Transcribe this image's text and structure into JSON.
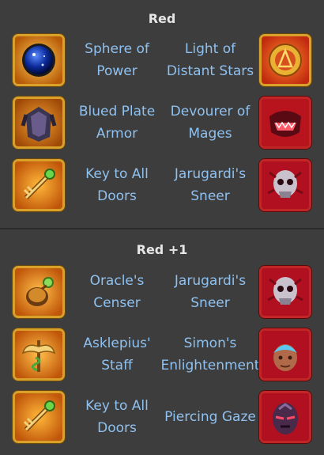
{
  "sections": [
    {
      "title": "Red",
      "rows": [
        {
          "left_name": "Sphere of\nPower",
          "left_icon": "sphere-of-power-icon",
          "right_name": "Light of\nDistant Stars",
          "right_icon": "light-of-distant-stars-icon"
        },
        {
          "left_name": "Blued Plate\nArmor",
          "left_icon": "blued-plate-armor-icon",
          "right_name": "Devourer of\nMages",
          "right_icon": "devourer-of-mages-icon"
        },
        {
          "left_name": "Key to All\nDoors",
          "left_icon": "key-to-all-doors-icon",
          "right_name": "Jarugardi's\nSneer",
          "right_icon": "jarugardis-sneer-icon"
        }
      ]
    },
    {
      "title": "Red +1",
      "rows": [
        {
          "left_name": "Oracle's\nCenser",
          "left_icon": "oracles-censer-icon",
          "right_name": "Jarugardi's\nSneer",
          "right_icon": "jarugardis-sneer-icon"
        },
        {
          "left_name": "Asklepius'\nStaff",
          "left_icon": "asklepius-staff-icon",
          "right_name": "Simon's\nEnlightenment",
          "right_icon": "simons-enlightenment-icon"
        },
        {
          "left_name": "Key to All\nDoors",
          "left_icon": "key-to-all-doors-icon",
          "right_name": "Piercing Gaze",
          "right_icon": "piercing-gaze-icon"
        }
      ]
    }
  ]
}
